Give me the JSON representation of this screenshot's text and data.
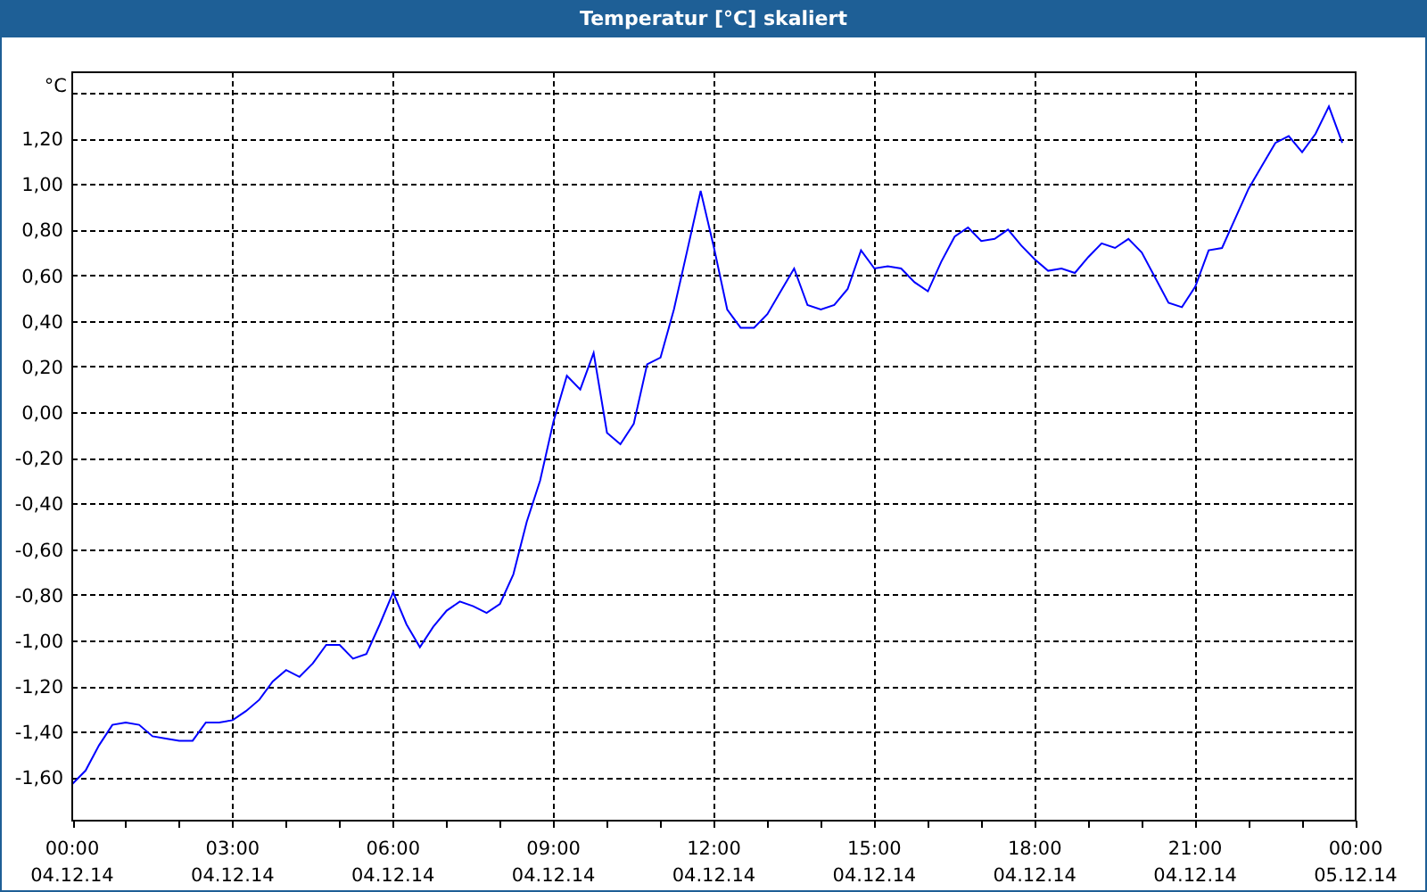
{
  "window": {
    "title": "Temperatur [°C] skaliert"
  },
  "chart_data": {
    "type": "line",
    "grid": true,
    "ylabel": "°C",
    "ylim": [
      -1.79,
      1.49
    ],
    "yticks": [
      {
        "value": 1.2,
        "label": "1,20"
      },
      {
        "value": 1.0,
        "label": "1,00"
      },
      {
        "value": 0.8,
        "label": "0,80"
      },
      {
        "value": 0.6,
        "label": "0,60"
      },
      {
        "value": 0.4,
        "label": "0,40"
      },
      {
        "value": 0.2,
        "label": "0,20"
      },
      {
        "value": 0,
        "label": "0,00"
      },
      {
        "value": -0.2,
        "label": "-0,20"
      },
      {
        "value": -0.4,
        "label": "-0,40"
      },
      {
        "value": -0.6,
        "label": "-0,60"
      },
      {
        "value": -0.8,
        "label": "-0,80"
      },
      {
        "value": -1.0,
        "label": "-1,00"
      },
      {
        "value": -1.2,
        "label": "-1,20"
      },
      {
        "value": -1.4,
        "label": "-1,40"
      },
      {
        "value": -1.6,
        "label": "-1,60"
      }
    ],
    "categories": [
      "00:00\n04.12.14",
      null,
      null,
      null,
      null,
      null,
      null,
      null,
      null,
      null,
      null,
      null,
      "03:00\n04.12.14",
      null,
      null,
      null,
      null,
      null,
      null,
      null,
      null,
      null,
      null,
      null,
      "06:00\n04.12.14",
      null,
      null,
      null,
      null,
      null,
      null,
      null,
      null,
      null,
      null,
      null,
      "09:00\n04.12.14",
      null,
      null,
      null,
      null,
      null,
      null,
      null,
      null,
      null,
      null,
      null,
      "12:00\n04.12.14",
      null,
      null,
      null,
      null,
      null,
      null,
      null,
      null,
      null,
      null,
      null,
      "15:00\n04.12.14",
      null,
      null,
      null,
      null,
      null,
      null,
      null,
      null,
      null,
      null,
      null,
      "18:00\n04.12.14",
      null,
      null,
      null,
      null,
      null,
      null,
      null,
      null,
      null,
      null,
      null,
      "21:00\n04.12.14",
      null,
      null,
      null,
      null,
      null,
      null,
      null,
      null,
      null,
      null,
      null,
      "00:00\n05.12.14"
    ],
    "series": [
      {
        "color": "#0000ff",
        "values": [
          -1.63,
          -1.57,
          -1.46,
          -1.37,
          -1.36,
          -1.37,
          -1.42,
          -1.43,
          -1.44,
          -1.44,
          -1.36,
          -1.36,
          -1.35,
          -1.31,
          -1.26,
          -1.18,
          -1.13,
          -1.16,
          -1.1,
          -1.02,
          -1.02,
          -1.08,
          -1.06,
          -0.93,
          -0.79,
          -0.93,
          -1.03,
          -0.94,
          -0.87,
          -0.83,
          -0.85,
          -0.88,
          -0.84,
          -0.71,
          -0.48,
          -0.3,
          -0.04,
          0.16,
          0.1,
          0.26,
          -0.09,
          -0.14,
          -0.05,
          0.21,
          0.24,
          0.45,
          0.71,
          0.97,
          0.72,
          0.45,
          0.37,
          0.37,
          0.43,
          0.53,
          0.63,
          0.47,
          0.45,
          0.47,
          0.54,
          0.71,
          0.63,
          0.64,
          0.63,
          0.57,
          0.53,
          0.66,
          0.77,
          0.81,
          0.75,
          0.76,
          0.8,
          0.73,
          0.67,
          0.62,
          0.63,
          0.61,
          0.68,
          0.74,
          0.72,
          0.76,
          0.7,
          0.59,
          0.48,
          0.46,
          0.55,
          0.71,
          0.72,
          0.85,
          0.98,
          1.08,
          1.18,
          1.21,
          1.14,
          1.22,
          1.34,
          1.18,
          null
        ]
      }
    ]
  }
}
